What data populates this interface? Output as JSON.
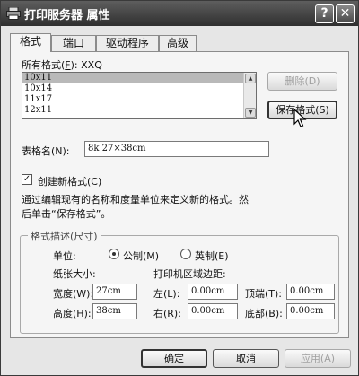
{
  "window": {
    "title": "打印服务器 属性",
    "help_button": "?",
    "close_button": "✕"
  },
  "tabs": [
    {
      "label": "格式",
      "active": true
    },
    {
      "label": "端口",
      "active": false
    },
    {
      "label": "驱动程序",
      "active": false
    },
    {
      "label": "高级",
      "active": false
    }
  ],
  "formats": {
    "label_prefix": "所有格式(",
    "label_key": "F",
    "label_suffix": "): XXQ",
    "items": [
      "10x11",
      "10x14",
      "11x17",
      "12x11"
    ],
    "selected": "10x11",
    "delete_button": "删除(D)",
    "save_button": "保存格式(S)"
  },
  "form_name": {
    "label": "表格名(N):",
    "value": "8k 27×38cm"
  },
  "create_new": {
    "label": "创建新格式(C)",
    "checked": true,
    "help_line1": "通过编辑现有的名称和度量单位来定义新的格式。然",
    "help_line2": "后单击“保存格式”。"
  },
  "format_description": {
    "title": "格式描述(尺寸)",
    "unit_label": "单位:",
    "metric": {
      "label": "公制(M)",
      "selected": true
    },
    "imperial": {
      "label": "英制(E)",
      "selected": false
    },
    "paper_size_label": "纸张大小:",
    "margins_label": "打印机区域边距:",
    "width_label": "宽度(W):",
    "width_value": "27cm",
    "height_label": "高度(H):",
    "height_value": "38cm",
    "left_label": "左(L):",
    "left_value": "0.00cm",
    "right_label": "右(R):",
    "right_value": "0.00cm",
    "top_label": "顶端(T):",
    "top_value": "0.00cm",
    "bottom_label": "底部(B):",
    "bottom_value": "0.00cm"
  },
  "footer": {
    "ok": "确定",
    "cancel": "取消",
    "apply": "应用(A)"
  }
}
